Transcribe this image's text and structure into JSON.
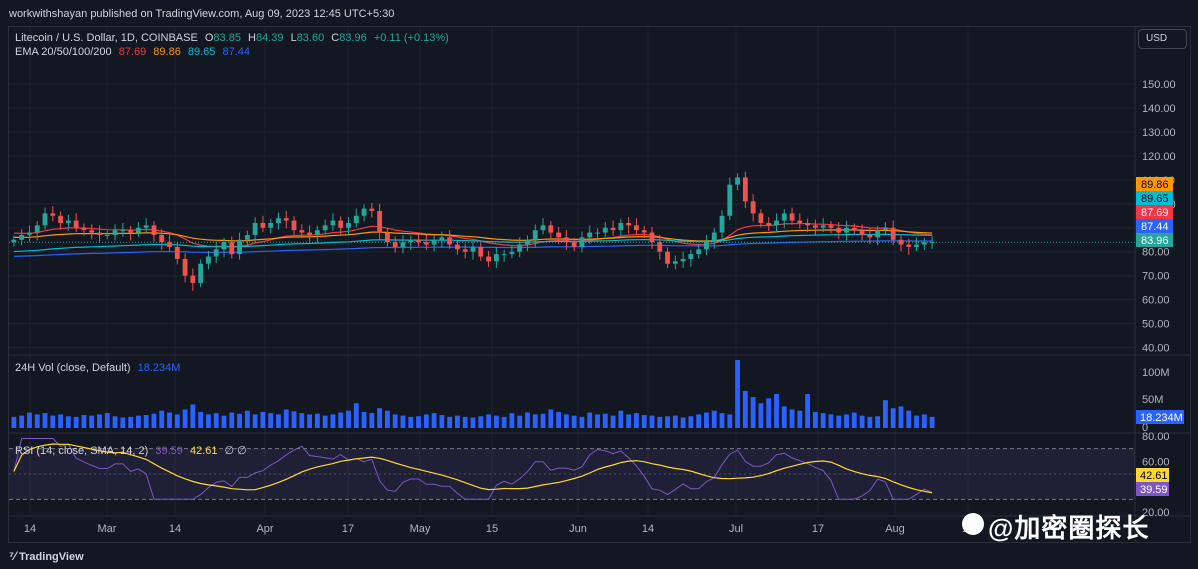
{
  "header": {
    "published": "workwithshayan published on TradingView.com, Aug 09, 2023 12:45 UTC+5:30"
  },
  "legend": {
    "symbol": "Litecoin / U.S. Dollar, 1D, COINBASE",
    "o_label": "O",
    "o_val": "83.85",
    "h_label": "H",
    "h_val": "84.39",
    "l_label": "L",
    "l_val": "83.60",
    "c_label": "C",
    "c_val": "83.96",
    "change": "+0.11 (+0.13%)",
    "ema_label": "EMA 20/50/100/200",
    "ema20": "87.69",
    "ema50": "89.86",
    "ema100": "89.65",
    "ema200": "87.44",
    "vol_label": "24H Vol (close, Default)",
    "vol_val": "18.234M",
    "rsi_label": "RSI (14, close, SMA, 14, 2)",
    "rsi_val": "39.59",
    "rsi_sma": "42.61",
    "rsi_extra": "∅ ∅"
  },
  "currency_button": "USD",
  "footer": {
    "brand": "TradingView"
  },
  "watermark": "@加密圈探长",
  "colors": {
    "up": "#26a69a",
    "down": "#ef5350",
    "ema20": "#f23645",
    "ema50": "#ff9800",
    "ema100": "#00bcd4",
    "ema200": "#2962ff",
    "volume": "#2962ff",
    "rsi": "#7e57c2",
    "rsi_sma": "#fdd835",
    "background": "#131722"
  },
  "chart_data": {
    "type": "candlestick",
    "price_axis": {
      "ticks": [
        "150.00",
        "140.00",
        "130.00",
        "120.00",
        "110.00",
        "100.00",
        "90.00",
        "80.00",
        "70.00",
        "60.00",
        "50.00",
        "40.00"
      ],
      "range": [
        39,
        160
      ]
    },
    "price_badges": [
      {
        "label": "89.86",
        "value": 89.86,
        "color": "#ff9800"
      },
      {
        "label": "89.65",
        "value": 89.65,
        "color": "#00bcd4"
      },
      {
        "label": "87.69",
        "value": 87.69,
        "color": "#f23645"
      },
      {
        "label": "87.44",
        "value": 87.44,
        "color": "#2962ff"
      },
      {
        "label": "83.96",
        "value": 83.96,
        "color": "#26a69a"
      }
    ],
    "x_labels": [
      "14",
      "Mar",
      "14",
      "Apr",
      "17",
      "May",
      "15",
      "Jun",
      "14",
      "Jul",
      "17",
      "Aug",
      "14"
    ],
    "closes": [
      85,
      87,
      88,
      91,
      96,
      95,
      92,
      93,
      90,
      89,
      88,
      87,
      87,
      89,
      89,
      88,
      90,
      91,
      87,
      84,
      82,
      77,
      70,
      67,
      75,
      78,
      81,
      84,
      79,
      85,
      87,
      92,
      90,
      92,
      94,
      93,
      89,
      88,
      87,
      89,
      91,
      93,
      90,
      92,
      95,
      98,
      97,
      88,
      84,
      82,
      84,
      85,
      84,
      83,
      85,
      86,
      83,
      81,
      80,
      82,
      78,
      76,
      79,
      79,
      80,
      83,
      85,
      89,
      91,
      88,
      86,
      84,
      82,
      86,
      88,
      88,
      90,
      89,
      92,
      91,
      89,
      88,
      84,
      80,
      75,
      76,
      77,
      79,
      81,
      84,
      88,
      95,
      108,
      111,
      101,
      96,
      92,
      91,
      93,
      96,
      93,
      92,
      91,
      90,
      91,
      90,
      88,
      90,
      89,
      87,
      86,
      89,
      90,
      85,
      83,
      82,
      83,
      84,
      84
    ],
    "volume_axis": {
      "ticks": [
        "100M",
        "50M",
        "0"
      ],
      "last": "18.234M"
    },
    "volume_values_m": [
      18,
      20,
      25,
      22,
      24,
      20,
      22,
      19,
      18,
      21,
      20,
      22,
      24,
      19,
      17,
      18,
      20,
      21,
      23,
      28,
      25,
      22,
      30,
      38,
      26,
      22,
      24,
      20,
      25,
      23,
      28,
      22,
      26,
      24,
      22,
      30,
      27,
      24,
      22,
      23,
      20,
      22,
      25,
      28,
      40,
      26,
      24,
      32,
      28,
      22,
      20,
      18,
      19,
      22,
      24,
      21,
      18,
      20,
      18,
      17,
      19,
      22,
      20,
      18,
      24,
      20,
      25,
      22,
      23,
      30,
      26,
      22,
      20,
      18,
      25,
      22,
      23,
      20,
      28,
      22,
      24,
      21,
      20,
      18,
      19,
      20,
      17,
      19,
      22,
      25,
      28,
      24,
      22,
      110,
      60,
      50,
      40,
      48,
      55,
      35,
      30,
      28,
      55,
      26,
      24,
      22,
      20,
      22,
      25,
      20,
      18,
      19,
      45,
      32,
      35,
      28,
      20,
      22,
      18
    ],
    "rsi_axis": {
      "ticks": [
        "80.00",
        "60.00",
        "40.00",
        "20.00"
      ],
      "last_rsi": "39.59",
      "last_sma": "42.61"
    }
  }
}
